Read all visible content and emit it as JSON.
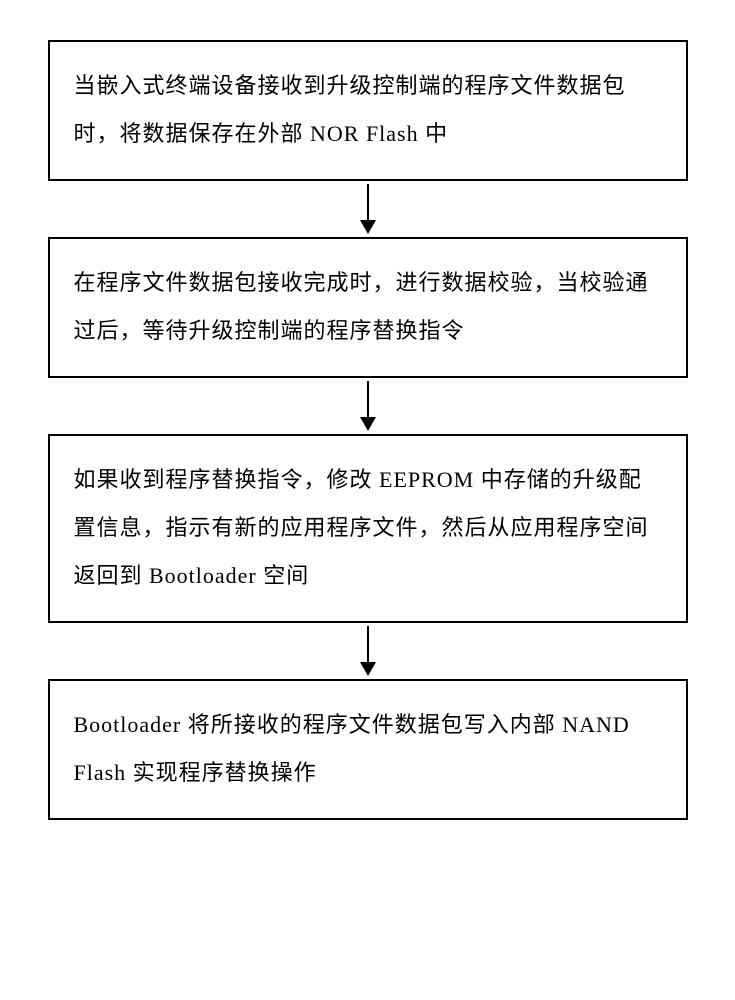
{
  "flowchart": {
    "steps": [
      {
        "text": "当嵌入式终端设备接收到升级控制端的程序文件数据包时，将数据保存在外部 NOR Flash 中"
      },
      {
        "text": "在程序文件数据包接收完成时，进行数据校验，当校验通过后，等待升级控制端的程序替换指令"
      },
      {
        "text": "如果收到程序替换指令，修改 EEPROM 中存储的升级配置信息，指示有新的应用程序文件，然后从应用程序空间返回到 Bootloader 空间"
      },
      {
        "text": "Bootloader 将所接收的程序文件数据包写入内部 NAND Flash 实现程序替换操作"
      }
    ]
  }
}
